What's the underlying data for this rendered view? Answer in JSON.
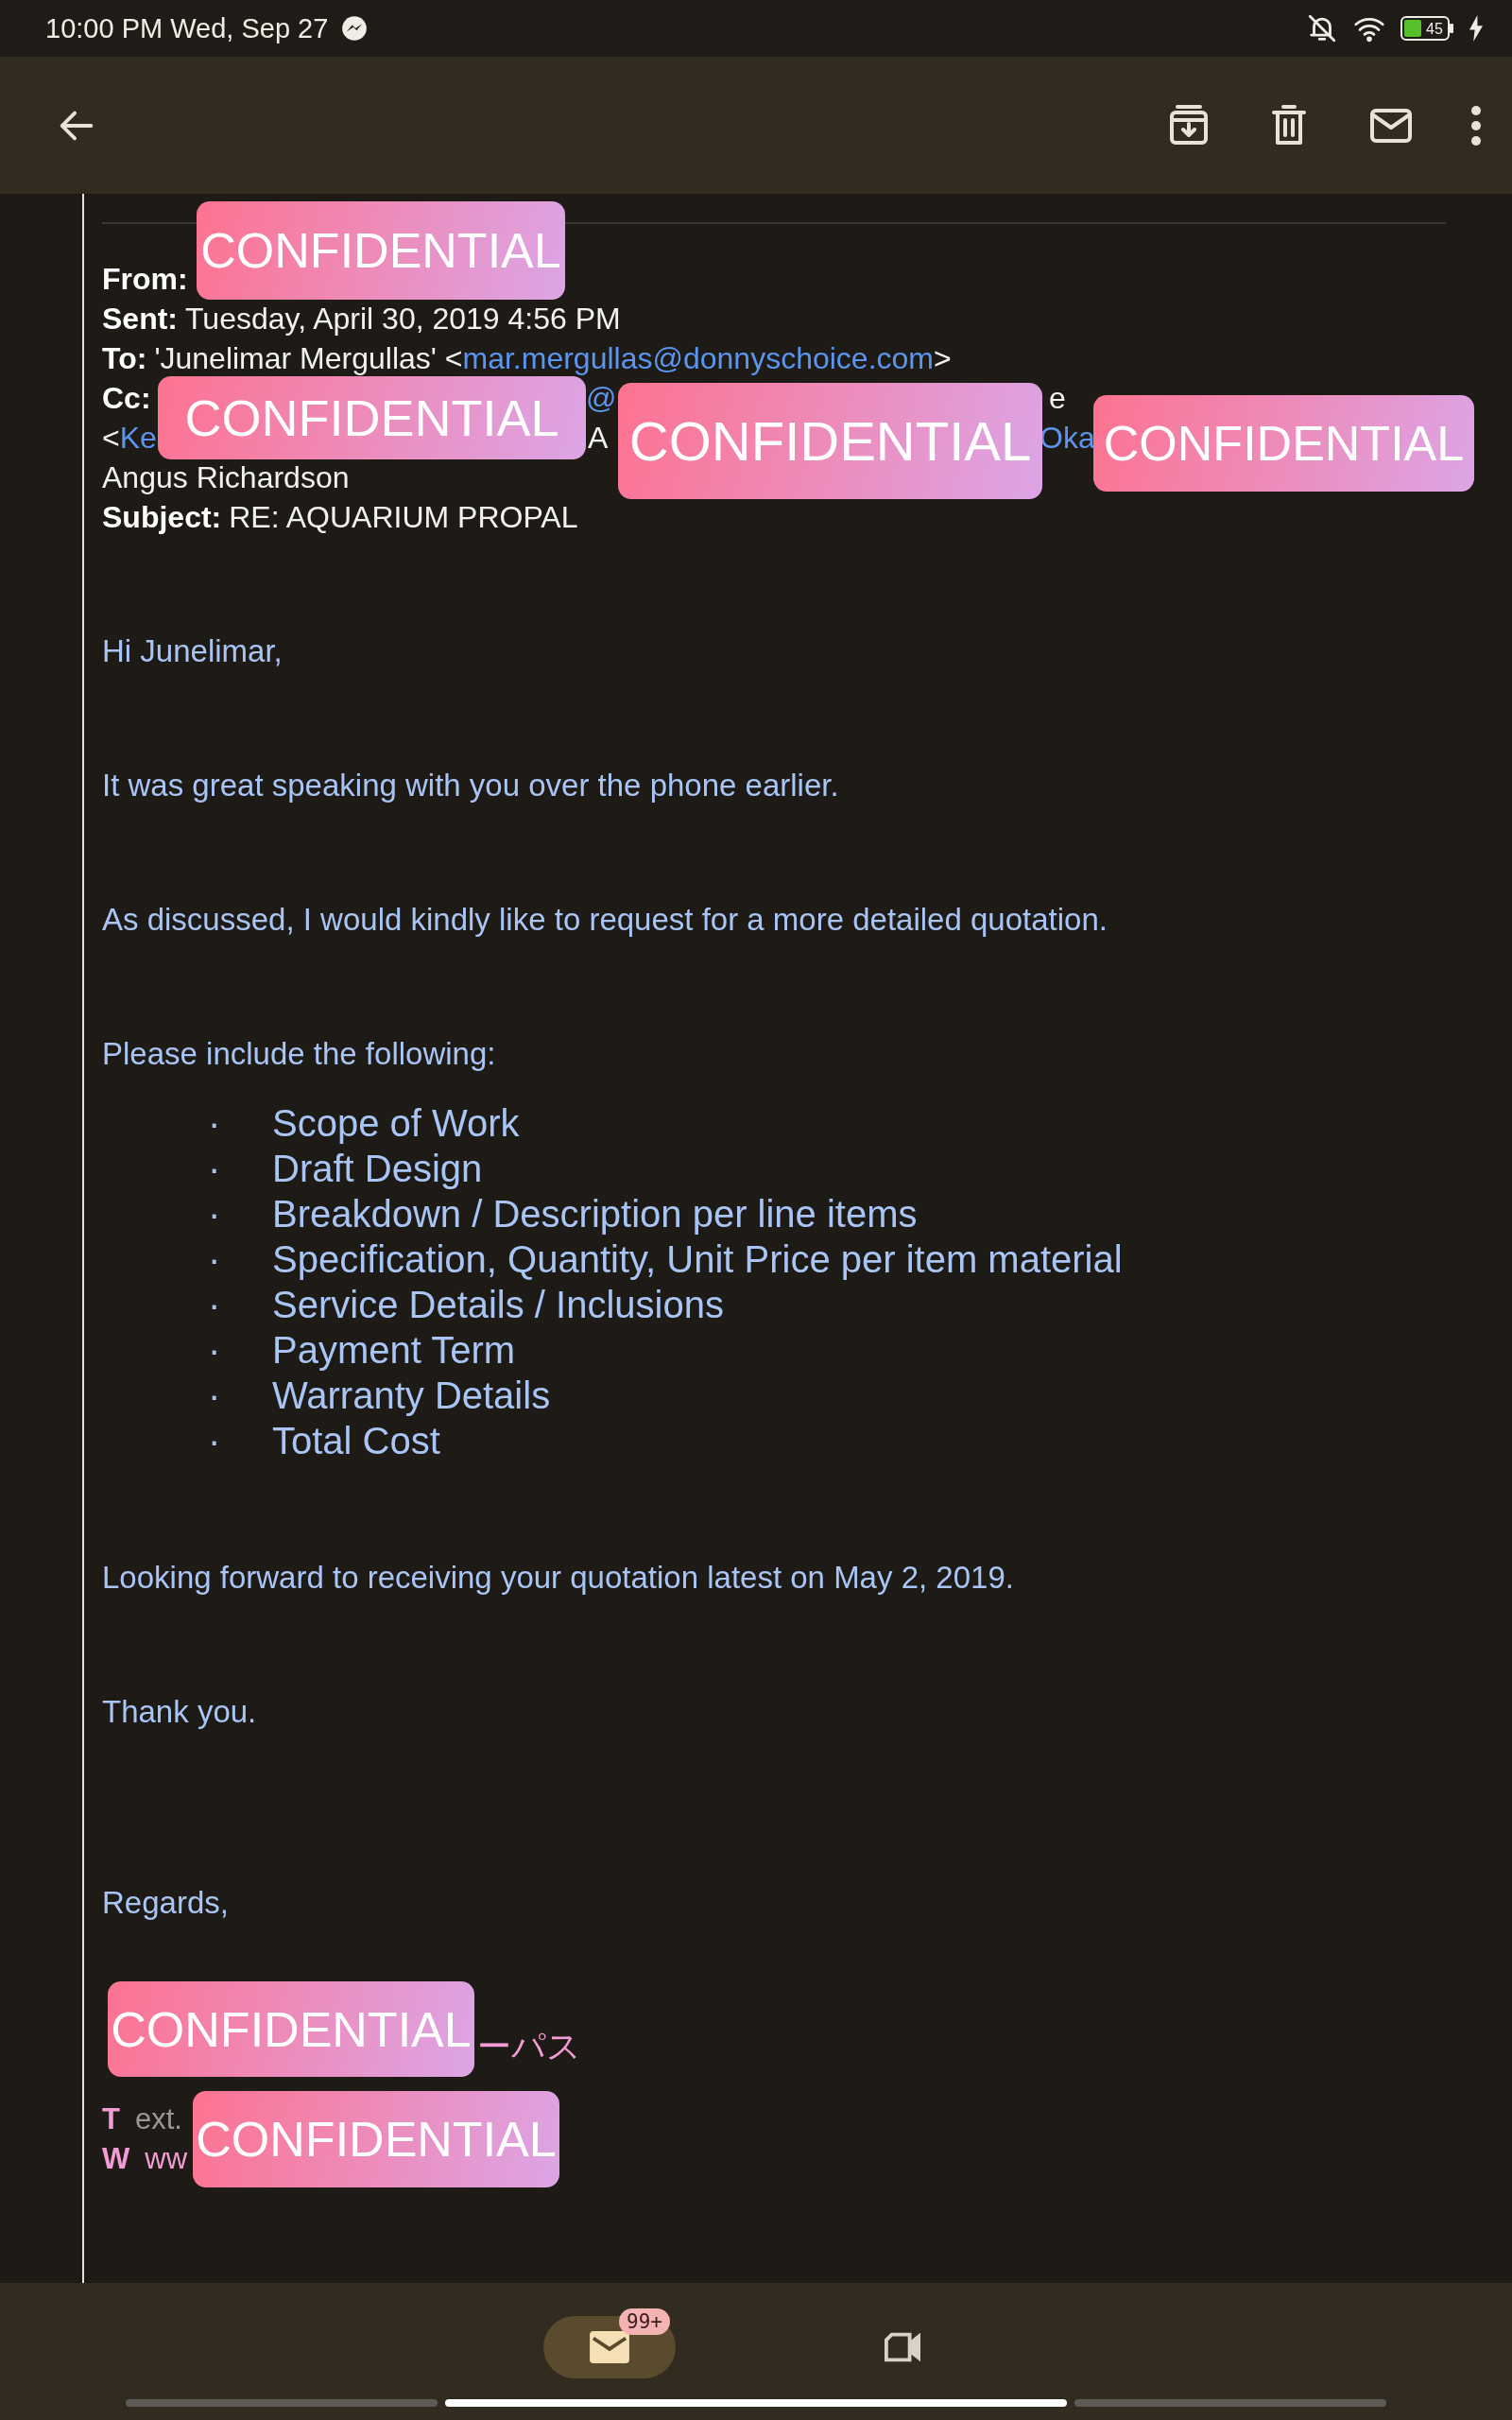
{
  "status_bar": {
    "time": "10:00 PM Wed, Sep 27",
    "battery": "45"
  },
  "email": {
    "header": [
      {
        "label": "From:"
      },
      {
        "label": "Sent:",
        "parts": [
          {
            "text": "Tuesday, April 30, 2019 4:56 PM",
            "kind": "plain"
          }
        ]
      },
      {
        "label": "To:",
        "parts": [
          {
            "text": "'Junelimar Mergullas' <",
            "kind": "plain"
          },
          {
            "text": "mar.mergullas@donnyschoice.com",
            "kind": "link"
          },
          {
            "text": ">",
            "kind": "plain"
          }
        ]
      },
      {
        "label": "Cc:",
        "parts": [
          {
            "text": "@",
            "kind": "link"
          },
          {
            "text": "e",
            "kind": "plain"
          }
        ]
      },
      {
        "parts": [
          {
            "text": "<",
            "kind": "plain"
          },
          {
            "text": "Ke",
            "kind": "link"
          },
          {
            "text": "A",
            "kind": "plain"
          },
          {
            "text": "Oka",
            "kind": "link"
          }
        ]
      },
      {
        "parts": [
          {
            "text": "Angus Richardson",
            "kind": "plain"
          }
        ]
      },
      {
        "label": "Subject:",
        "parts": [
          {
            "text": "RE: AQUARIUM PROPAL",
            "kind": "plain"
          }
        ]
      }
    ],
    "body": [
      {
        "kind": "paragraph",
        "text": "Hi Junelimar,"
      },
      {
        "kind": "paragraph",
        "text": "It was great speaking with you over the phone earlier."
      },
      {
        "kind": "paragraph",
        "text": "As discussed, I would kindly like to request for a more detailed quotation."
      },
      {
        "kind": "paragraph",
        "text": "Please include the following:"
      },
      {
        "kind": "list",
        "items": [
          {
            "bullet": "·",
            "text": "Scope of Work"
          },
          {
            "bullet": "·",
            "text": "Draft Design"
          },
          {
            "bullet": "·",
            "text": "Breakdown / Description per line items"
          },
          {
            "bullet": "·",
            "text": "Specification, Quantity, Unit Price per item material"
          },
          {
            "bullet": "·",
            "text": "Service Details / Inclusions"
          },
          {
            "bullet": "·",
            "text": "Payment Term"
          },
          {
            "bullet": "·",
            "text": "Warranty Details"
          },
          {
            "bullet": "·",
            "text": "Total Cost"
          }
        ]
      },
      {
        "kind": "paragraph",
        "text": "Looking forward to receiving your quotation latest on May 2, 2019."
      },
      {
        "kind": "paragraph",
        "text": "Thank you."
      },
      {
        "kind": "paragraph",
        "text": "Regards,"
      }
    ],
    "signature": {
      "name": "ーパス",
      "phone_label": "T",
      "phone": "ext.",
      "web_label": "W",
      "web": "ww"
    }
  },
  "redaction_stickers": [
    {
      "text": "CONFIDENTIAL"
    },
    {
      "text": "CONFIDENTIAL"
    },
    {
      "text": "CONFIDENTIAL"
    },
    {
      "text": "CONFIDENTIAL"
    },
    {
      "text": "CONFIDENTIAL"
    },
    {
      "text": "CONFIDENTIAL"
    }
  ],
  "bottom_nav": [
    {
      "kind": "mail",
      "selected": true,
      "badge": "99+"
    },
    {
      "kind": "video",
      "selected": false
    }
  ]
}
